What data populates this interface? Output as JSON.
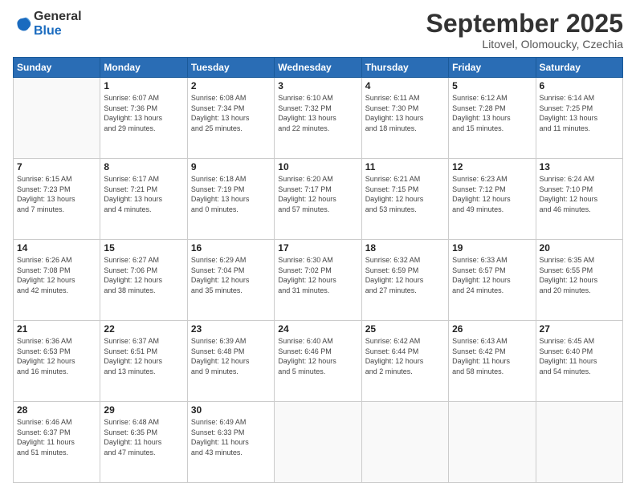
{
  "logo": {
    "line1": "General",
    "line2": "Blue"
  },
  "title": "September 2025",
  "subtitle": "Litovel, Olomoucky, Czechia",
  "header_days": [
    "Sunday",
    "Monday",
    "Tuesday",
    "Wednesday",
    "Thursday",
    "Friday",
    "Saturday"
  ],
  "weeks": [
    [
      {
        "day": "",
        "info": ""
      },
      {
        "day": "1",
        "info": "Sunrise: 6:07 AM\nSunset: 7:36 PM\nDaylight: 13 hours\nand 29 minutes."
      },
      {
        "day": "2",
        "info": "Sunrise: 6:08 AM\nSunset: 7:34 PM\nDaylight: 13 hours\nand 25 minutes."
      },
      {
        "day": "3",
        "info": "Sunrise: 6:10 AM\nSunset: 7:32 PM\nDaylight: 13 hours\nand 22 minutes."
      },
      {
        "day": "4",
        "info": "Sunrise: 6:11 AM\nSunset: 7:30 PM\nDaylight: 13 hours\nand 18 minutes."
      },
      {
        "day": "5",
        "info": "Sunrise: 6:12 AM\nSunset: 7:28 PM\nDaylight: 13 hours\nand 15 minutes."
      },
      {
        "day": "6",
        "info": "Sunrise: 6:14 AM\nSunset: 7:25 PM\nDaylight: 13 hours\nand 11 minutes."
      }
    ],
    [
      {
        "day": "7",
        "info": "Sunrise: 6:15 AM\nSunset: 7:23 PM\nDaylight: 13 hours\nand 7 minutes."
      },
      {
        "day": "8",
        "info": "Sunrise: 6:17 AM\nSunset: 7:21 PM\nDaylight: 13 hours\nand 4 minutes."
      },
      {
        "day": "9",
        "info": "Sunrise: 6:18 AM\nSunset: 7:19 PM\nDaylight: 13 hours\nand 0 minutes."
      },
      {
        "day": "10",
        "info": "Sunrise: 6:20 AM\nSunset: 7:17 PM\nDaylight: 12 hours\nand 57 minutes."
      },
      {
        "day": "11",
        "info": "Sunrise: 6:21 AM\nSunset: 7:15 PM\nDaylight: 12 hours\nand 53 minutes."
      },
      {
        "day": "12",
        "info": "Sunrise: 6:23 AM\nSunset: 7:12 PM\nDaylight: 12 hours\nand 49 minutes."
      },
      {
        "day": "13",
        "info": "Sunrise: 6:24 AM\nSunset: 7:10 PM\nDaylight: 12 hours\nand 46 minutes."
      }
    ],
    [
      {
        "day": "14",
        "info": "Sunrise: 6:26 AM\nSunset: 7:08 PM\nDaylight: 12 hours\nand 42 minutes."
      },
      {
        "day": "15",
        "info": "Sunrise: 6:27 AM\nSunset: 7:06 PM\nDaylight: 12 hours\nand 38 minutes."
      },
      {
        "day": "16",
        "info": "Sunrise: 6:29 AM\nSunset: 7:04 PM\nDaylight: 12 hours\nand 35 minutes."
      },
      {
        "day": "17",
        "info": "Sunrise: 6:30 AM\nSunset: 7:02 PM\nDaylight: 12 hours\nand 31 minutes."
      },
      {
        "day": "18",
        "info": "Sunrise: 6:32 AM\nSunset: 6:59 PM\nDaylight: 12 hours\nand 27 minutes."
      },
      {
        "day": "19",
        "info": "Sunrise: 6:33 AM\nSunset: 6:57 PM\nDaylight: 12 hours\nand 24 minutes."
      },
      {
        "day": "20",
        "info": "Sunrise: 6:35 AM\nSunset: 6:55 PM\nDaylight: 12 hours\nand 20 minutes."
      }
    ],
    [
      {
        "day": "21",
        "info": "Sunrise: 6:36 AM\nSunset: 6:53 PM\nDaylight: 12 hours\nand 16 minutes."
      },
      {
        "day": "22",
        "info": "Sunrise: 6:37 AM\nSunset: 6:51 PM\nDaylight: 12 hours\nand 13 minutes."
      },
      {
        "day": "23",
        "info": "Sunrise: 6:39 AM\nSunset: 6:48 PM\nDaylight: 12 hours\nand 9 minutes."
      },
      {
        "day": "24",
        "info": "Sunrise: 6:40 AM\nSunset: 6:46 PM\nDaylight: 12 hours\nand 5 minutes."
      },
      {
        "day": "25",
        "info": "Sunrise: 6:42 AM\nSunset: 6:44 PM\nDaylight: 12 hours\nand 2 minutes."
      },
      {
        "day": "26",
        "info": "Sunrise: 6:43 AM\nSunset: 6:42 PM\nDaylight: 11 hours\nand 58 minutes."
      },
      {
        "day": "27",
        "info": "Sunrise: 6:45 AM\nSunset: 6:40 PM\nDaylight: 11 hours\nand 54 minutes."
      }
    ],
    [
      {
        "day": "28",
        "info": "Sunrise: 6:46 AM\nSunset: 6:37 PM\nDaylight: 11 hours\nand 51 minutes."
      },
      {
        "day": "29",
        "info": "Sunrise: 6:48 AM\nSunset: 6:35 PM\nDaylight: 11 hours\nand 47 minutes."
      },
      {
        "day": "30",
        "info": "Sunrise: 6:49 AM\nSunset: 6:33 PM\nDaylight: 11 hours\nand 43 minutes."
      },
      {
        "day": "",
        "info": ""
      },
      {
        "day": "",
        "info": ""
      },
      {
        "day": "",
        "info": ""
      },
      {
        "day": "",
        "info": ""
      }
    ]
  ]
}
